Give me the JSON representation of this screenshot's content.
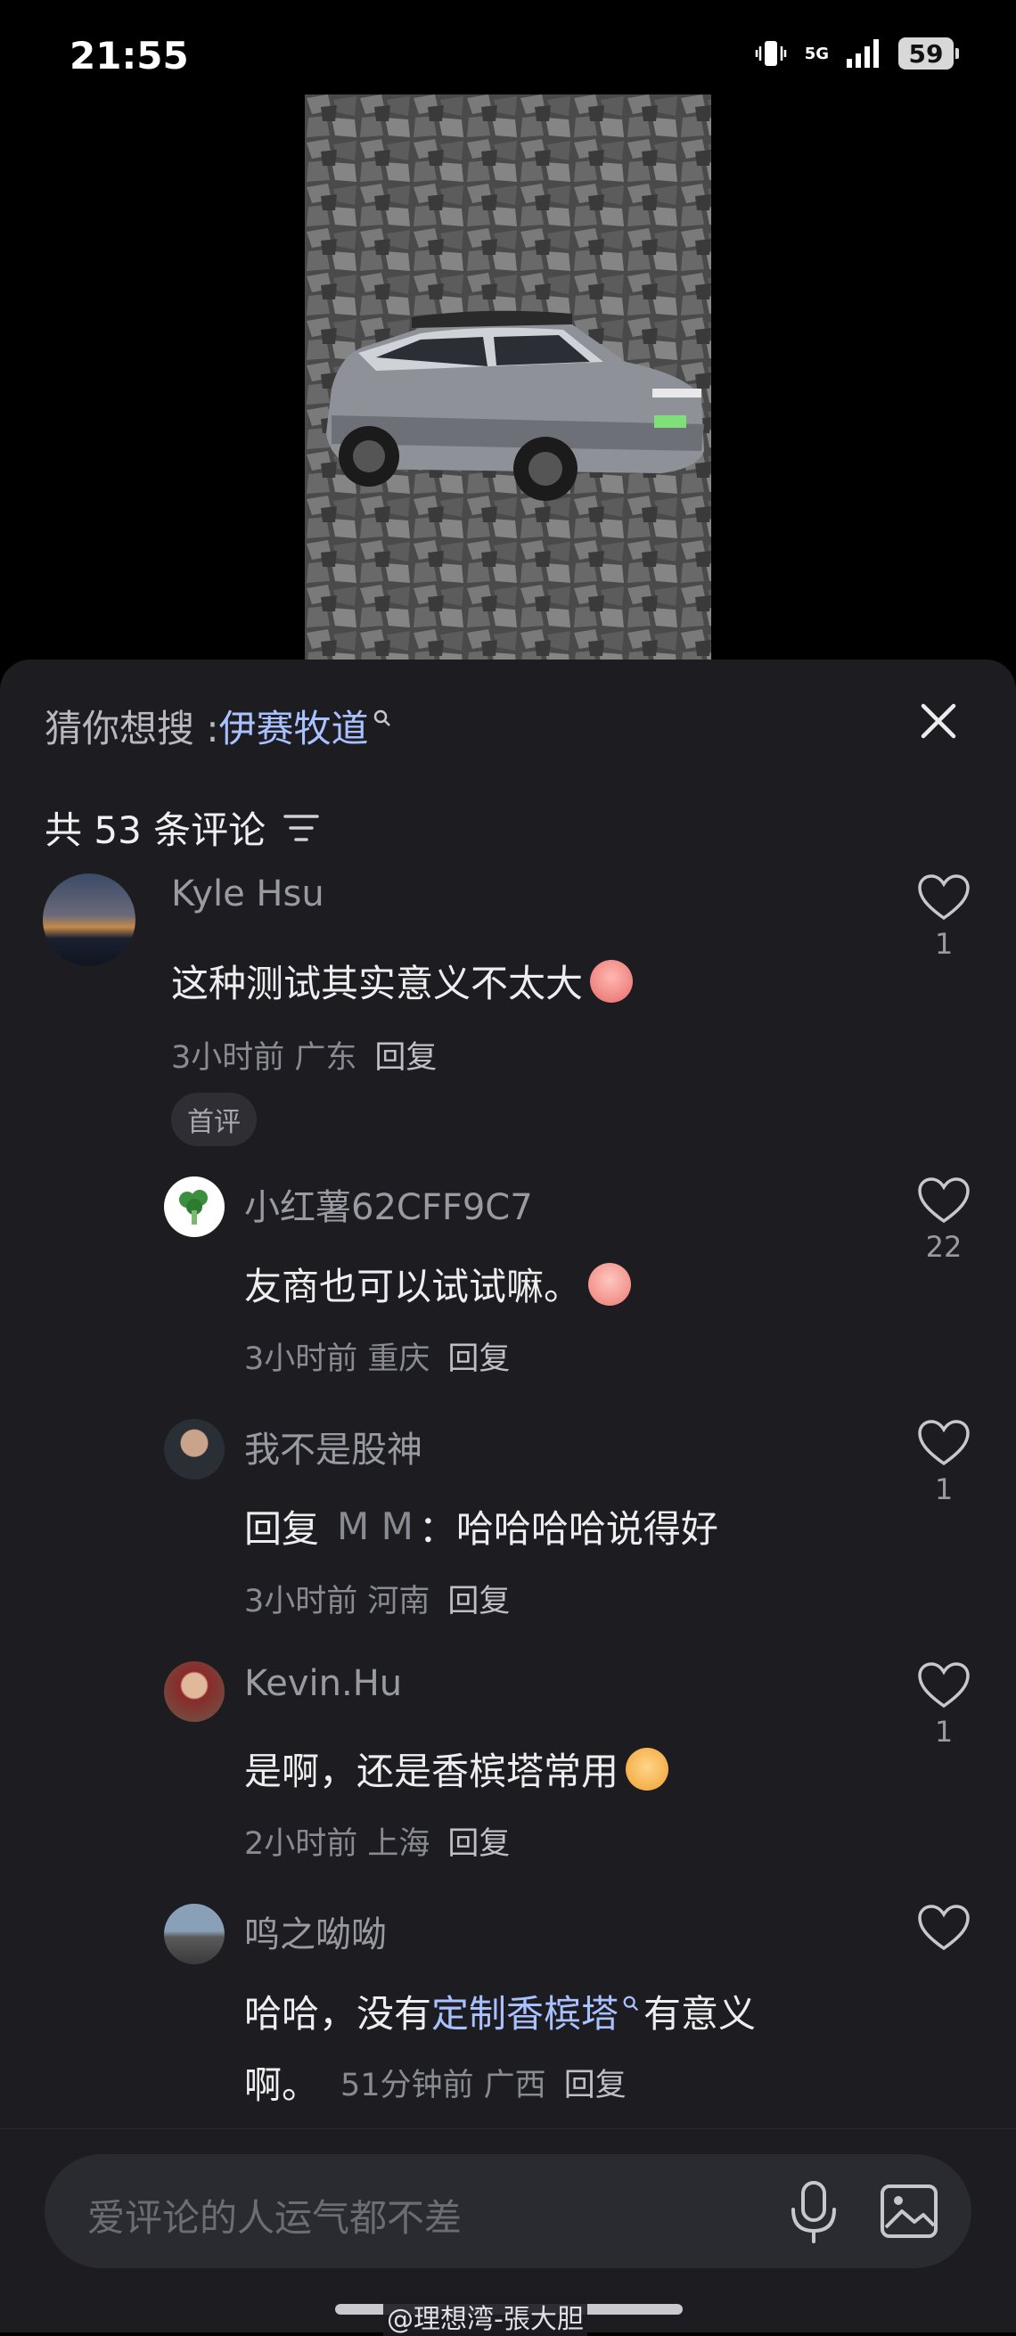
{
  "status": {
    "time": "21:55",
    "network": "5G",
    "battery": "59"
  },
  "search": {
    "label": "猜你想搜 : ",
    "term": "伊赛牧道"
  },
  "comments_header": {
    "count_text": "共 53 条评论"
  },
  "comments": [
    {
      "user": "Kyle Hsu",
      "text": "这种测试其实意义不太大",
      "meta": "3小时前 广东",
      "reply": "回复",
      "likes": "1",
      "badge": "首评"
    },
    {
      "user": "小红薯62CFF9C7",
      "text": "友商也可以试试嘛。",
      "meta": "3小时前 重庆",
      "reply": "回复",
      "likes": "22"
    },
    {
      "user": "我不是股神",
      "text_prefix": "回复",
      "mention": "M M",
      "text": "：哈哈哈哈说得好",
      "meta": "3小时前 河南",
      "reply": "回复",
      "likes": "1"
    },
    {
      "user": "Kevin.Hu",
      "text": "是啊，还是香槟塔常用",
      "meta": "2小时前 上海",
      "reply": "回复",
      "likes": "1"
    },
    {
      "user": "鸣之呦呦",
      "text_prefix": "哈哈，没有 ",
      "link": "定制香槟塔",
      "text_suffix": " 有意义",
      "text_line2": "啊。",
      "meta": "51分钟前 广西",
      "reply": "回复"
    }
  ],
  "input": {
    "placeholder": "爱评论的人运气都不差"
  },
  "watermark": "@理想湾-張大胆",
  "colors": {
    "panel": "#1c1c21",
    "link": "#a9c2ff",
    "muted": "#8a8a92"
  }
}
